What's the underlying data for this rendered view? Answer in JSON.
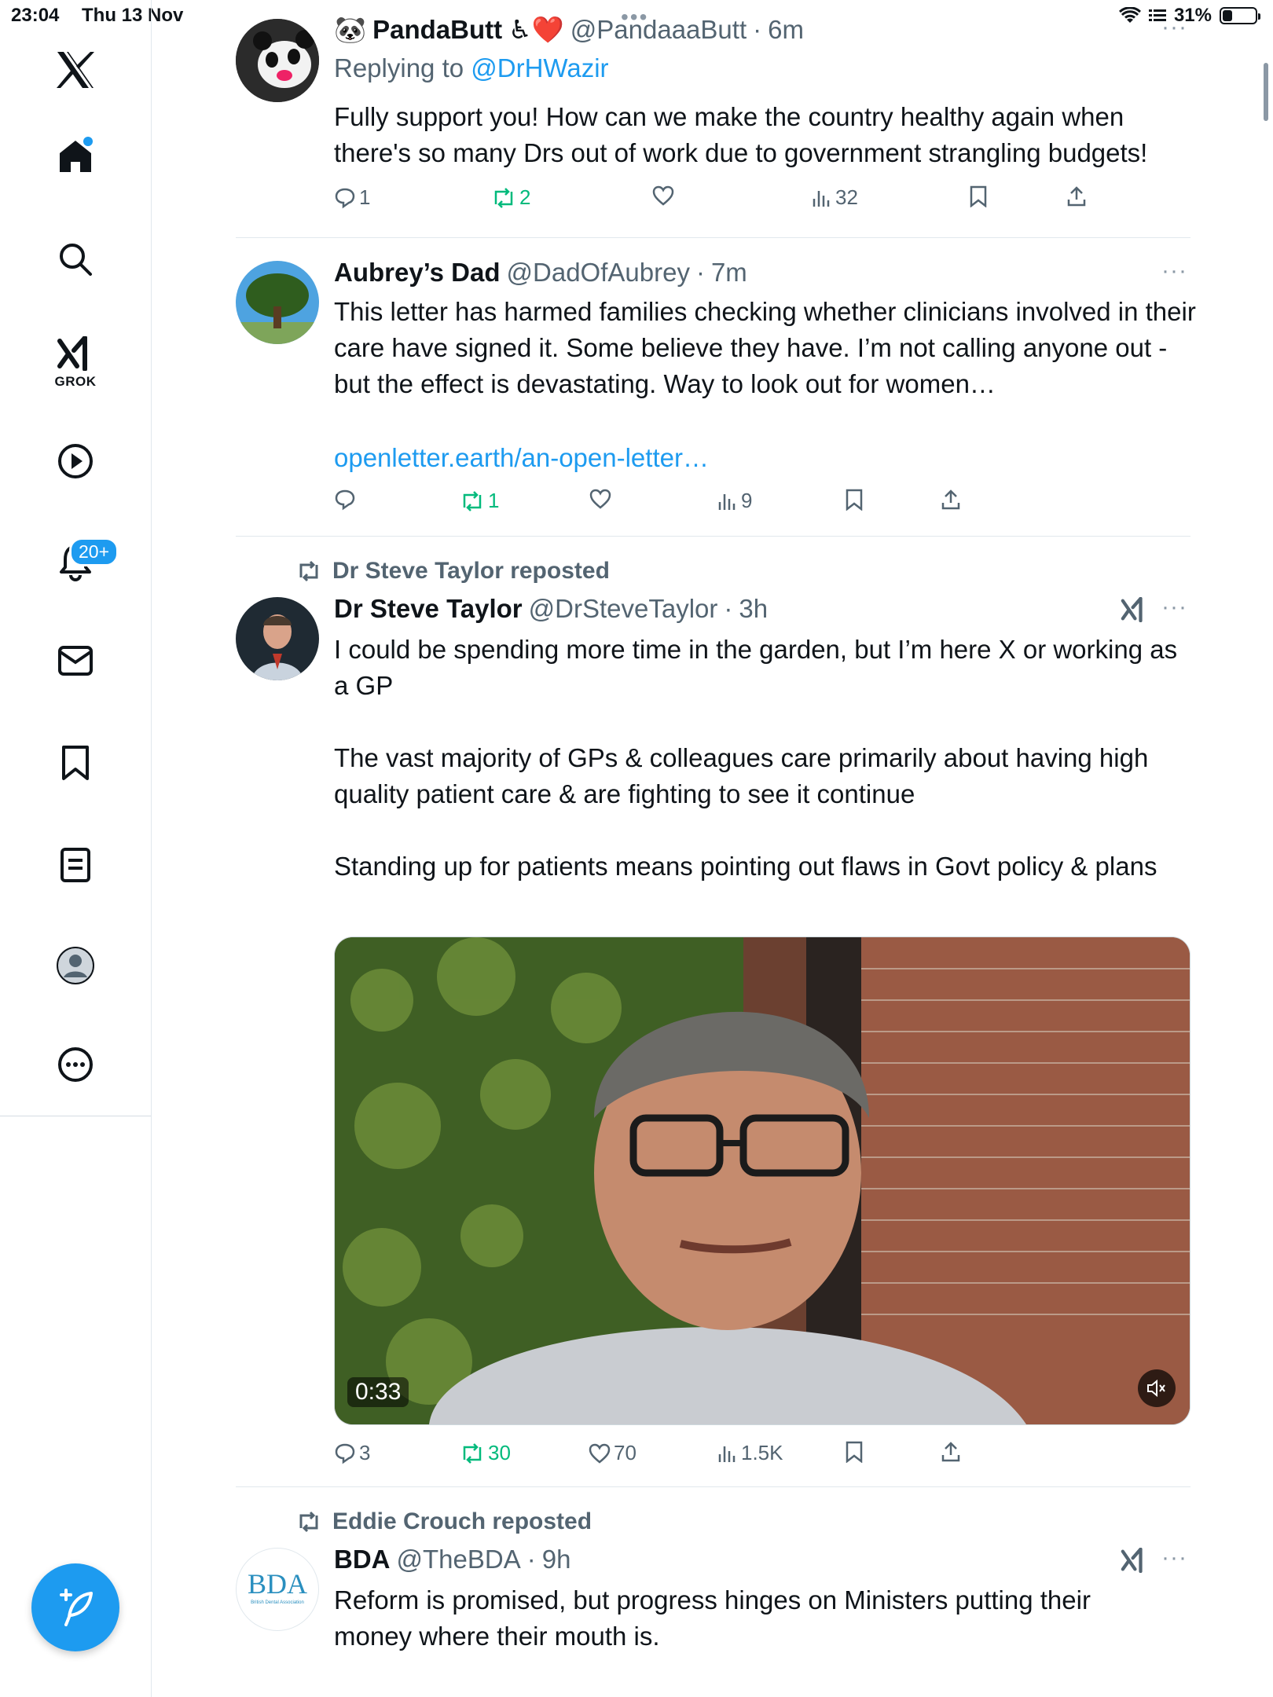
{
  "status_bar": {
    "time": "23:04",
    "date": "Thu 13 Nov",
    "battery": "31%",
    "battery_level": 0.31
  },
  "sidebar": {
    "grok_label": "GROK",
    "notifications_badge": "20+"
  },
  "tweets": [
    {
      "name": "PandaButt",
      "name_prefix_emoji": "🐼",
      "name_suffix_emoji": "♿❤️",
      "handle": "@PandaaaButt",
      "time": "6m",
      "replying_label": "Replying to",
      "replying_to": "@DrHWazir",
      "text": "Fully support you! How can we make the country healthy again when there's so many Drs out of work due to government strangling budgets!",
      "replies": "1",
      "reposts": "2",
      "likes": "",
      "views": "32"
    },
    {
      "name": "Aubrey’s Dad",
      "handle": "@DadOfAubrey",
      "time": "7m",
      "text": "This letter has harmed families checking whether clinicians involved in their care have signed it. Some believe they have. I’m not calling anyone out -  but the effect is devastating.  Way to look out for women…",
      "link": "openletter.earth/an-open-letter…",
      "replies": "",
      "reposts": "1",
      "likes": "",
      "views": "9"
    },
    {
      "reposted_by": "Dr Steve Taylor reposted",
      "name": "Dr Steve Taylor",
      "handle": "@DrSteveTaylor",
      "time": "3h",
      "text_p1": "I could be spending more time in the garden, but I’m here X or working as a GP",
      "text_p2": "The vast majority of GPs & colleagues care primarily about having high quality patient care & are fighting to see it continue",
      "text_p3": "Standing up for patients means pointing out flaws in Govt policy & plans",
      "video_time": "0:33",
      "replies": "3",
      "reposts": "30",
      "likes": "70",
      "views": "1.5K"
    },
    {
      "reposted_by": "Eddie Crouch reposted",
      "name": "BDA",
      "handle": "@TheBDA",
      "time": "9h",
      "avatar_text": "BDA",
      "avatar_subtext": "British Dental Association",
      "text": "Reform is promised, but progress hinges on Ministers putting their money where their mouth is."
    }
  ],
  "separator": "·",
  "colors": {
    "accent": "#1d9bf0",
    "repost_green": "#00ba7c",
    "secondary_text": "#536471"
  }
}
